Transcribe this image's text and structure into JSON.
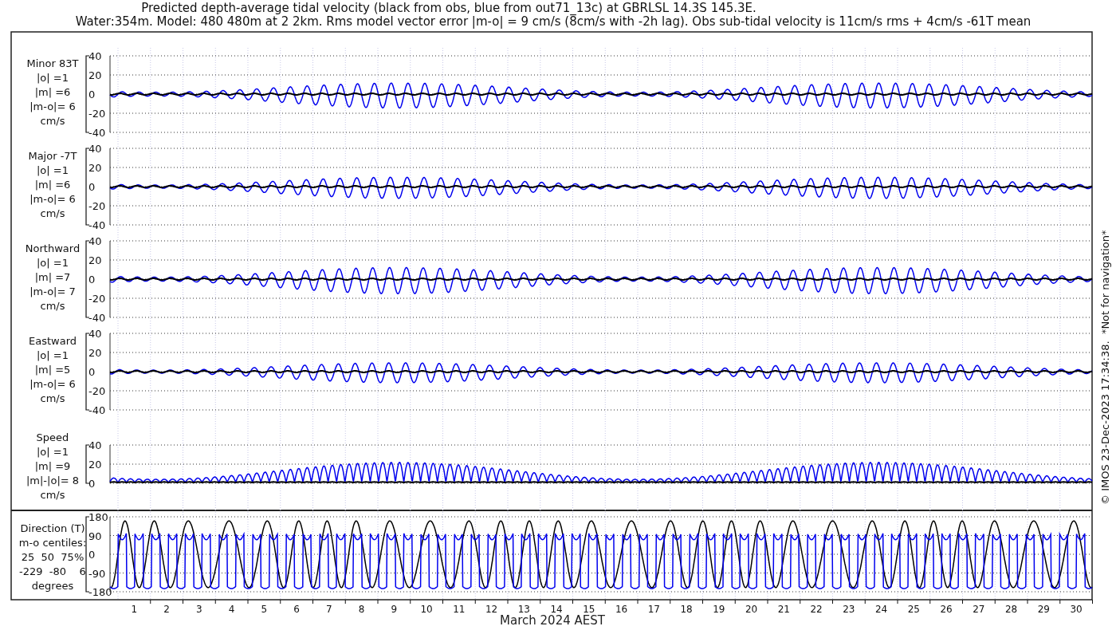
{
  "title": "Predicted depth-average tidal velocity (black from obs, blue from out71_13c) at GBRLSL 14.3S 145.3E.",
  "subtitle": "Water:354m. Model: 480 480m at 2 2km. Rms model vector error |m-o| = 9 cm/s (8cm/s with -2h lag). Obs sub-tidal velocity is 11cm/s rms + 4cm/s -61T mean",
  "panels": [
    {
      "kind": "velocity",
      "label_lines": [
        "Minor 83T",
        "|o| =1",
        "|m| =6",
        "|m-o|= 6",
        "cm/s"
      ],
      "yticks": [
        "40",
        "20",
        "0",
        "-20",
        "-40"
      ]
    },
    {
      "kind": "velocity",
      "label_lines": [
        "Major -7T",
        "|o| =1",
        "|m| =6",
        "|m-o|= 6",
        "cm/s"
      ],
      "yticks": [
        "40",
        "20",
        "0",
        "-20",
        "-40"
      ]
    },
    {
      "kind": "velocity",
      "label_lines": [
        "Northward",
        "|o| =1",
        "|m| =7",
        "|m-o|= 7",
        "cm/s"
      ],
      "yticks": [
        "40",
        "20",
        "0",
        "-20",
        "-40"
      ]
    },
    {
      "kind": "velocity",
      "label_lines": [
        "Eastward",
        "|o| =1",
        "|m| =5",
        "|m-o|= 6",
        "cm/s"
      ],
      "yticks": [
        "40",
        "20",
        "0",
        "-20",
        "-40"
      ]
    },
    {
      "kind": "speed",
      "label_lines": [
        "Speed",
        "|o| =1",
        "|m| =9",
        "|m|-|o|= 8",
        "cm/s"
      ],
      "yticks": [
        "40",
        "20",
        "0"
      ]
    },
    {
      "kind": "direction",
      "label_lines": [
        "Direction (T)",
        "m-o centiles:",
        "25  50  75%",
        "-229  -80    6",
        "degrees"
      ],
      "yticks": [
        "180",
        "90",
        "0",
        "-90",
        "-180"
      ]
    }
  ],
  "x_axis": {
    "labels": [
      "1",
      "2",
      "3",
      "4",
      "5",
      "6",
      "7",
      "8",
      "9",
      "10",
      "11",
      "12",
      "13",
      "14",
      "15",
      "16",
      "17",
      "18",
      "19",
      "20",
      "21",
      "22",
      "23",
      "24",
      "25",
      "26",
      "27",
      "28",
      "29",
      "30"
    ],
    "title": "March 2024 AEST"
  },
  "credit": "© IMOS 23-Dec-2023 17:34:38.  *Not for navigation*"
}
